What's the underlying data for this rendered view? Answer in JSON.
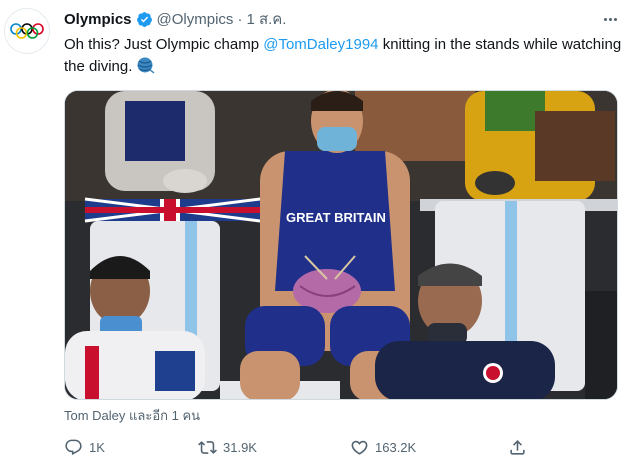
{
  "account": {
    "display_name": "Olympics",
    "handle": "@Olympics",
    "separator": "·",
    "timestamp": "1 ส.ค.",
    "verified": true
  },
  "tweet": {
    "text_before": "Oh this? Just Olympic champ ",
    "mention": "@TomDaley1994",
    "text_after": " knitting in the stands while watching the diving.",
    "emoji": "yarn-ball-icon"
  },
  "photo": {
    "jersey_text": "GREAT BRITAIN"
  },
  "social_context": "Tom Daley และอีก 1 คน",
  "actions": {
    "reply_count": "1K",
    "retweet_count": "31.9K",
    "like_count": "163.2K"
  },
  "colors": {
    "accent": "#1d9bf0",
    "secondary_text": "#536471",
    "primary_text": "#0f1419"
  }
}
